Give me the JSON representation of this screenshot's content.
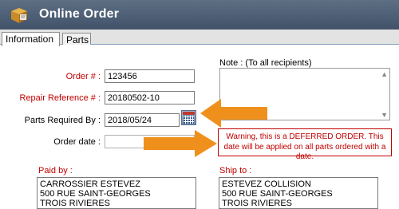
{
  "window": {
    "title": "Online Order",
    "icon": "package-icon"
  },
  "tabs": [
    {
      "label": "Information",
      "active": true
    },
    {
      "label": "Parts",
      "active": false
    }
  ],
  "form": {
    "order_number": {
      "label": "Order # :",
      "value": "123456"
    },
    "repair_reference": {
      "label": "Repair Reference # :",
      "value": "20180502-10"
    },
    "parts_required_by": {
      "label": "Parts Required By :",
      "value": "2018/05/24"
    },
    "order_date": {
      "label": "Order date :",
      "value": ""
    }
  },
  "note": {
    "label": "Note : (To all recipients)",
    "value": ""
  },
  "warning": "Warning, this is a DEFERRED ORDER. This date will be applied on all parts ordered with a date.",
  "paid_by": {
    "label": "Paid by :",
    "lines": [
      "CARROSSIER ESTEVEZ",
      "500 RUE SAINT-GEORGES",
      "TROIS RIVIERES"
    ]
  },
  "ship_to": {
    "label": "Ship to :",
    "lines": [
      "ESTEVEZ COLLISION",
      "500 RUE SAINT-GEORGES",
      "TROIS RIVIERES"
    ]
  },
  "colors": {
    "accent_red": "#c00000",
    "arrow_orange": "#f0901c",
    "title_bar": "#4d5e74"
  }
}
